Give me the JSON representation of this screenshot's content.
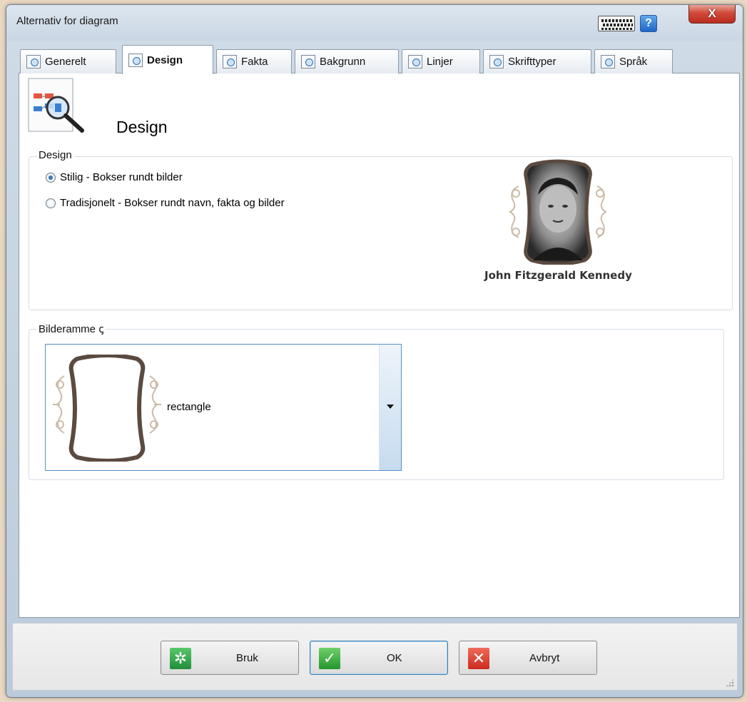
{
  "window": {
    "title": "Alternativ for diagram",
    "close_label": "X",
    "help_label": "?"
  },
  "tabs": [
    {
      "label": "Generelt",
      "icon": "general-tab-icon"
    },
    {
      "label": "Design",
      "icon": "design-tab-icon",
      "active": true
    },
    {
      "label": "Fakta",
      "icon": "facts-tab-icon"
    },
    {
      "label": "Bakgrunn",
      "icon": "background-tab-icon"
    },
    {
      "label": "Linjer",
      "icon": "lines-tab-icon"
    },
    {
      "label": "Skrifttyper",
      "icon": "fonts-tab-icon"
    },
    {
      "label": "Språk",
      "icon": "language-tab-icon"
    }
  ],
  "header": {
    "title": "Design"
  },
  "design_group": {
    "legend": "Design",
    "options": [
      {
        "label": "Stilig - Bokser rundt bilder",
        "checked": true
      },
      {
        "label": "Tradisjonelt - Bokser rundt navn, fakta og bilder",
        "checked": false
      }
    ],
    "preview_name": "John Fitzgerald Kennedy"
  },
  "frame_group": {
    "legend": "Bilderamme",
    "legend_suffix": "ꞔ",
    "selected_value": "rectangle"
  },
  "buttons": {
    "apply": "Bruk",
    "ok": "OK",
    "cancel": "Avbryt"
  },
  "colors": {
    "accent": "#1f66c8",
    "frame_brown": "#5b4a40",
    "close_red": "#c63b2b",
    "apply_green": "#2fa54a",
    "ok_green": "#38a93a",
    "cancel_red": "#d83a2c"
  }
}
